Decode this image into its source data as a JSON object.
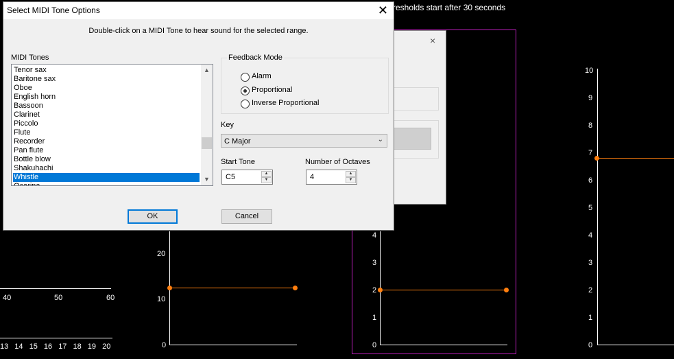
{
  "background": {
    "top_text": "resholds start after 30 seconds",
    "left_plot": {
      "x_ticks_top": [
        "40",
        "50",
        "60"
      ],
      "x_ticks_bottom": [
        "13",
        "14",
        "15",
        "16",
        "17",
        "18",
        "19",
        "20"
      ]
    },
    "mid_plot": {
      "y_ticks": [
        "20",
        "10",
        "0"
      ],
      "line_value": 12,
      "line_color": "#ff7f0e"
    },
    "magenta_plot": {
      "y_ticks": [
        "4",
        "3",
        "2",
        "1",
        "0"
      ],
      "line_value": 2,
      "border_color": "#c020c0"
    },
    "right_plot": {
      "y_ticks": [
        "10",
        "9",
        "8",
        "7",
        "6",
        "5",
        "4",
        "3",
        "2",
        "1",
        "0"
      ],
      "line_value": 6.8
    }
  },
  "back_dialog": {
    "close_icon": "×"
  },
  "dialog": {
    "title": "Select MIDI Tone Options",
    "close_icon": "✕",
    "instruction": "Double-click on a MIDI Tone to hear sound for the selected range.",
    "midi_tones_label": "MIDI Tones",
    "tones": [
      "Tenor sax",
      "Baritone sax",
      "Oboe",
      "English horn",
      "Bassoon",
      "Clarinet",
      "Piccolo",
      "Flute",
      "Recorder",
      "Pan flute",
      "Bottle blow",
      "Shakuhachi",
      "Whistle",
      "Ocarina"
    ],
    "selected_tone": "Whistle",
    "feedback_mode": {
      "label": "Feedback Mode",
      "options": [
        "Alarm",
        "Proportional",
        "Inverse Proportional"
      ],
      "selected": "Proportional"
    },
    "key": {
      "label": "Key",
      "value": "C Major"
    },
    "start_tone": {
      "label": "Start Tone",
      "value": "C5"
    },
    "octaves": {
      "label": "Number of Octaves",
      "value": "4"
    },
    "ok_label": "OK",
    "cancel_label": "Cancel"
  }
}
